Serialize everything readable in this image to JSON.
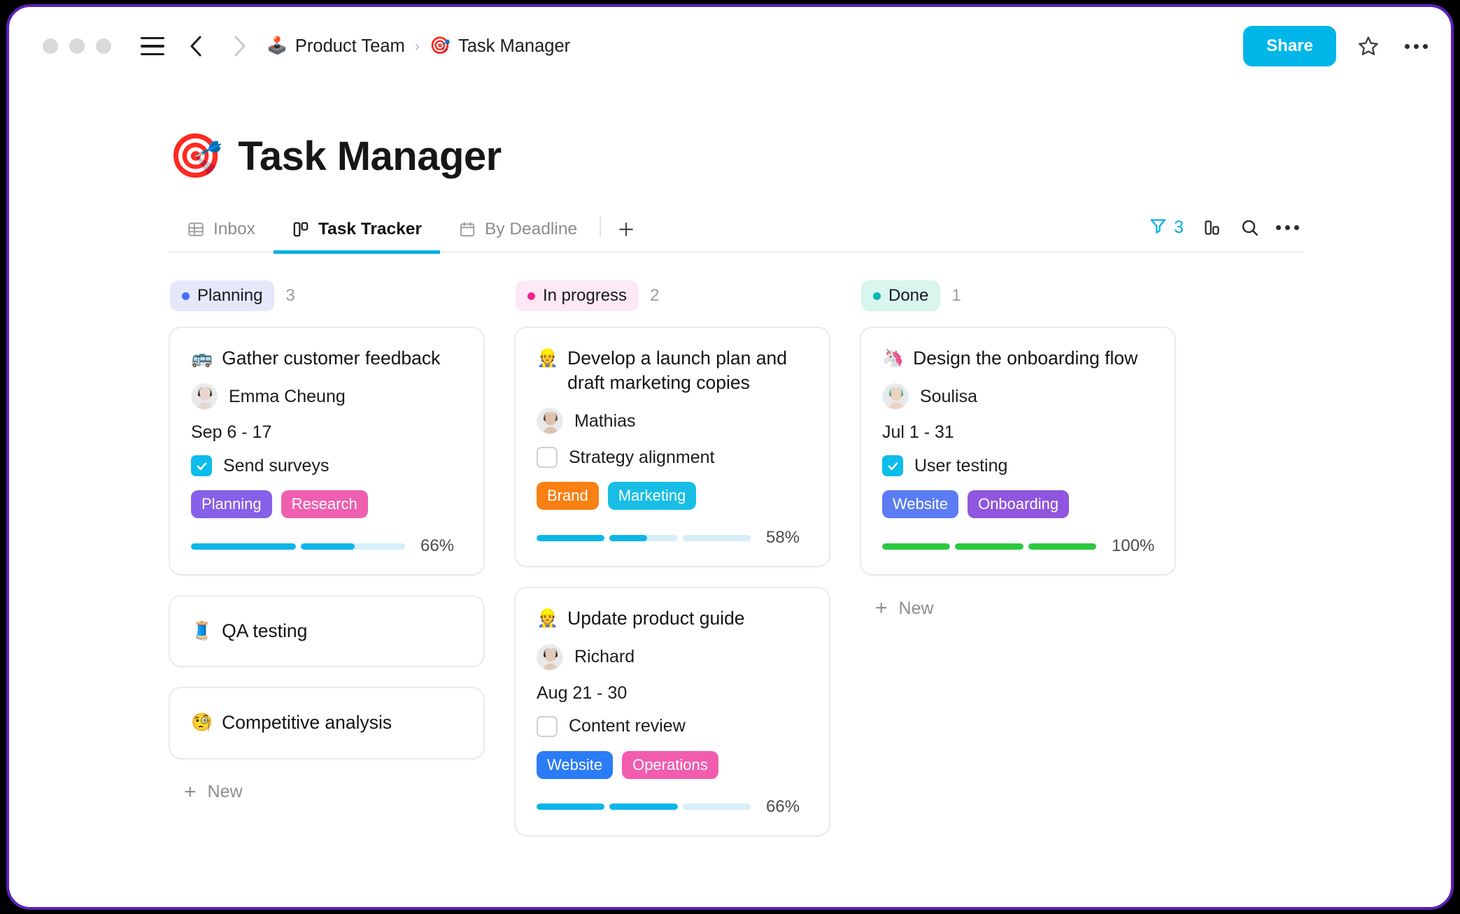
{
  "window": {
    "traffic_lights": [
      "close",
      "minimize",
      "maximize"
    ],
    "border_color": "#5b21b6"
  },
  "topbar": {
    "menu_icon": "hamburger-icon",
    "back_icon": "chevron-left-icon",
    "forward_icon": "chevron-right-icon",
    "breadcrumb": [
      {
        "emoji": "🕹️",
        "label": "Product Team"
      },
      {
        "emoji": "🎯",
        "label": "Task Manager"
      }
    ],
    "separator": "›",
    "share_label": "Share",
    "favorite_icon": "star-icon",
    "more_icon": "more-horizontal-icon"
  },
  "header": {
    "emoji": "🎯",
    "title": "Task Manager"
  },
  "tabs": [
    {
      "label": "Inbox",
      "icon": "table-icon",
      "active": false
    },
    {
      "label": "Task Tracker",
      "icon": "board-icon",
      "active": true
    },
    {
      "label": "By Deadline",
      "icon": "calendar-icon",
      "active": false
    }
  ],
  "tab_add_label": "+",
  "toolbar": {
    "filter_icon": "filter-icon",
    "filter_count": "3",
    "filter_color": "#00b0e6",
    "group_icon": "group-by-icon",
    "search_icon": "search-icon",
    "more_icon": "more-horizontal-icon"
  },
  "colors": {
    "accent": "#00b0e6",
    "progress_cyan": "#0cb6e8",
    "progress_track": "#d6eff9",
    "progress_green": "#2bc93f"
  },
  "board": {
    "new_label": "New",
    "columns": [
      {
        "name": "Planning",
        "count": "3",
        "dot_color": "#4a6df5",
        "pill_bg": "#e6e7fb",
        "show_new": true,
        "cards": [
          {
            "emoji": "🚌",
            "title": "Gather customer feedback",
            "assignee": "Emma Cheung",
            "avatar_colors": [
              "#e7d7cf",
              "#2b2119"
            ],
            "date": "Sep 6 - 17",
            "checkbox": {
              "checked": true,
              "label": "Send surveys"
            },
            "tags": [
              {
                "label": "Planning",
                "color": "#8660e8"
              },
              {
                "label": "Research",
                "color": "#ef5fb0"
              }
            ],
            "progress": {
              "percent": "66%",
              "segments": [
                1,
                0.52
              ],
              "color": "#0cb6e8"
            }
          },
          {
            "emoji": "🧵",
            "title": "QA testing",
            "simple": true
          },
          {
            "emoji": "🧐",
            "title": "Competitive analysis",
            "simple": true
          }
        ]
      },
      {
        "name": "In progress",
        "count": "2",
        "dot_color": "#f2268f",
        "pill_bg": "#fce9f5",
        "show_new": false,
        "cards": [
          {
            "emoji": "👷",
            "title": "Develop a launch plan and draft marketing copies",
            "assignee": "Mathias",
            "avatar_colors": [
              "#dcc2ab",
              "#5c3a22"
            ],
            "checkbox": {
              "checked": false,
              "label": "Strategy alignment"
            },
            "tags": [
              {
                "label": "Brand",
                "color": "#f98012"
              },
              {
                "label": "Marketing",
                "color": "#17bde4"
              }
            ],
            "progress": {
              "percent": "58%",
              "segments": [
                1,
                0.55,
                0
              ],
              "color": "#0cb6e8"
            }
          },
          {
            "emoji": "👷",
            "title": "Update product guide",
            "assignee": "Richard",
            "avatar_colors": [
              "#e0cbb8",
              "#241a13"
            ],
            "date": "Aug 21 - 30",
            "checkbox": {
              "checked": false,
              "label": "Content review"
            },
            "tags": [
              {
                "label": "Website",
                "color": "#2a7cf7"
              },
              {
                "label": "Operations",
                "color": "#f25cae"
              }
            ],
            "progress": {
              "percent": "66%",
              "segments": [
                1,
                1,
                0
              ],
              "color": "#0cb6e8"
            }
          }
        ]
      },
      {
        "name": "Done",
        "count": "1",
        "dot_color": "#06b6b6",
        "pill_bg": "#d8f5ee",
        "show_new": true,
        "cards": [
          {
            "emoji": "🦄",
            "title": "Design the onboarding flow",
            "assignee": "Soulisa",
            "avatar_colors": [
              "#f0d3bf",
              "#2fa68e"
            ],
            "date": "Jul 1 - 31",
            "checkbox": {
              "checked": true,
              "label": "User testing"
            },
            "tags": [
              {
                "label": "Website",
                "color": "#5b7cf2"
              },
              {
                "label": "Onboarding",
                "color": "#9056dd"
              }
            ],
            "progress": {
              "percent": "100%",
              "segments": [
                1,
                1,
                1
              ],
              "color": "#2bc93f"
            }
          }
        ]
      }
    ]
  }
}
